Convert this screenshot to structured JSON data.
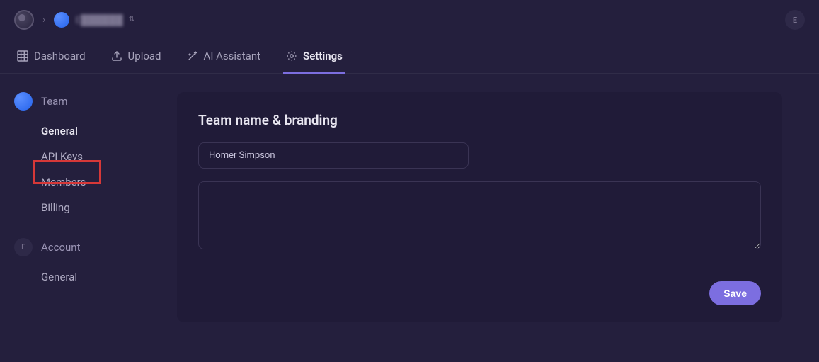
{
  "topbar": {
    "org_name": "E██████",
    "user_initial": "E"
  },
  "tabs": {
    "dashboard": "Dashboard",
    "upload": "Upload",
    "ai_assistant": "AI Assistant",
    "settings": "Settings"
  },
  "sidebar": {
    "team": {
      "label": "Team",
      "items": {
        "general": "General",
        "api_keys": "API Keys",
        "members": "Members",
        "billing": "Billing"
      }
    },
    "account": {
      "label": "Account",
      "initial": "E",
      "items": {
        "general": "General"
      }
    }
  },
  "card": {
    "title": "Team name & branding",
    "team_name": "Homer Simpson",
    "description": "",
    "save_label": "Save"
  },
  "highlight": {
    "target": "api_keys"
  }
}
